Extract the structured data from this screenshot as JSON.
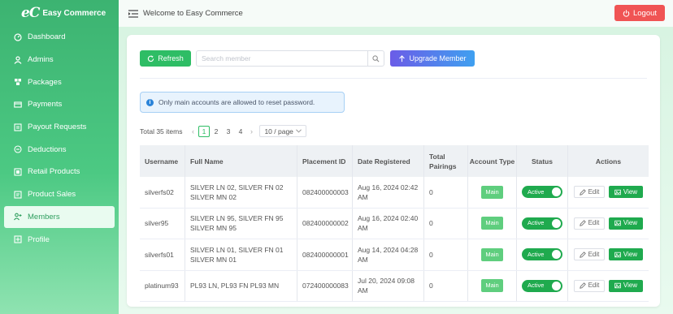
{
  "brand": {
    "logo": "eC",
    "name": "Easy Commerce"
  },
  "sidebar": {
    "items": [
      {
        "label": "Dashboard",
        "icon": "gauge-icon"
      },
      {
        "label": "Admins",
        "icon": "user-icon"
      },
      {
        "label": "Packages",
        "icon": "packages-icon"
      },
      {
        "label": "Payments",
        "icon": "payment-card-icon"
      },
      {
        "label": "Payout Requests",
        "icon": "payout-icon"
      },
      {
        "label": "Deductions",
        "icon": "minus-circle-icon"
      },
      {
        "label": "Retail Products",
        "icon": "retail-icon"
      },
      {
        "label": "Product Sales",
        "icon": "sales-icon"
      },
      {
        "label": "Members",
        "icon": "members-icon",
        "active": true
      },
      {
        "label": "Profile",
        "icon": "profile-icon"
      }
    ]
  },
  "header": {
    "welcome": "Welcome to Easy Commerce",
    "logout_label": "Logout"
  },
  "toolbar": {
    "refresh_label": "Refresh",
    "search_placeholder": "Search member",
    "search_value": "",
    "upgrade_label": "Upgrade Member"
  },
  "info": {
    "text": "Only main accounts are allowed to reset password."
  },
  "pager": {
    "total": "Total 35 items",
    "pages": [
      "1",
      "2",
      "3",
      "4"
    ],
    "current": "1",
    "page_size": "10 / page"
  },
  "table": {
    "headers": {
      "username": "Username",
      "full_name": "Full Name",
      "placement_id": "Placement ID",
      "date_registered": "Date Registered",
      "total_pairings": "Total Pairings",
      "account_type": "Account Type",
      "status": "Status",
      "actions": "Actions"
    },
    "rows": [
      {
        "username": "silverfs02",
        "full_name": "SILVER LN 02, SILVER FN 02 SILVER MN 02",
        "placement_id": "082400000003",
        "date_registered": "Aug 16, 2024 02:42 AM",
        "total_pairings": "0",
        "account_type": "Main",
        "status": "Active",
        "edit": "Edit",
        "view": "View"
      },
      {
        "username": "silver95",
        "full_name": "SILVER LN 95, SILVER FN 95 SILVER MN 95",
        "placement_id": "082400000002",
        "date_registered": "Aug 16, 2024 02:40 AM",
        "total_pairings": "0",
        "account_type": "Main",
        "status": "Active",
        "edit": "Edit",
        "view": "View"
      },
      {
        "username": "silverfs01",
        "full_name": "SILVER LN 01, SILVER FN 01 SILVER MN 01",
        "placement_id": "082400000001",
        "date_registered": "Aug 14, 2024 04:28 AM",
        "total_pairings": "0",
        "account_type": "Main",
        "status": "Active",
        "edit": "Edit",
        "view": "View"
      },
      {
        "username": "platinum93",
        "full_name": "PL93 LN, PL93 FN PL93 MN",
        "placement_id": "072400000083",
        "date_registered": "Jul 20, 2024 09:08 AM",
        "total_pairings": "0",
        "account_type": "Main",
        "status": "Active",
        "edit": "Edit",
        "view": "View"
      }
    ]
  },
  "colors": {
    "brand_green": "#2ebd65",
    "logout_red": "#f05454",
    "info_blue": "#2b84d9"
  }
}
